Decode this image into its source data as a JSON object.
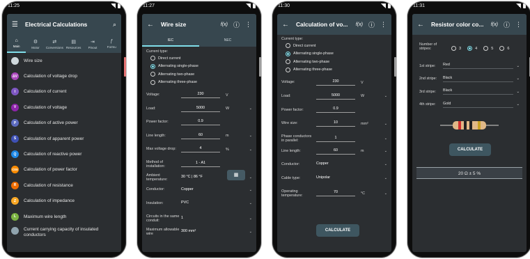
{
  "colors": {
    "appbar": "#37474f",
    "screen_bg": "#2b2e31",
    "accent": "#80deea",
    "power_btn_left": "#e57373"
  },
  "phone1": {
    "status_time": "11:25",
    "title": "Electrical Calculations",
    "tabs": [
      {
        "label": "Main",
        "icon": "home-icon"
      },
      {
        "label": "Motor",
        "icon": "motor-icon"
      },
      {
        "label": "Conversions",
        "icon": "conversion-icon"
      },
      {
        "label": "Resources",
        "icon": "book-icon"
      },
      {
        "label": "Pinout",
        "icon": "pinout-icon"
      },
      {
        "label": "Formu",
        "icon": "formula-icon"
      }
    ],
    "items": [
      {
        "label": "Wire size",
        "badge": "",
        "color": "#cfd8dc"
      },
      {
        "label": "Calculation of voltage drop",
        "badge": "ΔV",
        "color": "#ab47bc"
      },
      {
        "label": "Calculation of current",
        "badge": "I",
        "color": "#7e57c2"
      },
      {
        "label": "Calculation of voltage",
        "badge": "V",
        "color": "#8e24aa"
      },
      {
        "label": "Calculation of active power",
        "badge": "P",
        "color": "#5c6bc0"
      },
      {
        "label": "Calculation of apparent power",
        "badge": "S",
        "color": "#3f51b5"
      },
      {
        "label": "Calculation of reactive power",
        "badge": "Q",
        "color": "#1e88e5"
      },
      {
        "label": "Calculation of power factor",
        "badge": "cos",
        "color": "#fb8c00"
      },
      {
        "label": "Calculation of resistance",
        "badge": "R",
        "color": "#ef6c00"
      },
      {
        "label": "Calculation of impedance",
        "badge": "Z",
        "color": "#f9a825"
      },
      {
        "label": "Maximum wire length",
        "badge": "L",
        "color": "#7cb342"
      },
      {
        "label": "Current carrying capacity of insulated conductors",
        "badge": "",
        "color": "#90a4ae"
      }
    ]
  },
  "phone2": {
    "status_time": "11:27",
    "title": "Wire size",
    "formula_label": "f(x)",
    "tabs": [
      "IEC",
      "NEC"
    ],
    "current_type_label": "Current type:",
    "current_types": [
      "Direct current",
      "Alternating single-phase",
      "Alternating two-phase",
      "Alternating three-phase"
    ],
    "selected_index": 1,
    "fields": [
      {
        "label": "Voltage:",
        "value": "230",
        "unit": "V",
        "dropdown": false
      },
      {
        "label": "Load:",
        "value": "5000",
        "unit": "W",
        "dropdown": true
      },
      {
        "label": "Power factor:",
        "value": "0.9",
        "unit": "",
        "dropdown": false
      },
      {
        "label": "Line length:",
        "value": "60",
        "unit": "m",
        "dropdown": true
      },
      {
        "label": "Max voltage drop:",
        "value": "4",
        "unit": "%",
        "dropdown": true
      },
      {
        "label": "Method of installation:",
        "value": "1 - A1",
        "unit": "",
        "dropdown": false
      },
      {
        "label": "Ambient temperature:",
        "value": "30 °C | 86 °F",
        "unit": "",
        "dropdown": true
      },
      {
        "label": "Conductor:",
        "value": "Copper",
        "unit": "",
        "dropdown": true
      },
      {
        "label": "Insulation:",
        "value": "PVC",
        "unit": "",
        "dropdown": true
      },
      {
        "label": "Circuits in the same conduit:",
        "value": "1",
        "unit": "",
        "dropdown": true
      },
      {
        "label": "Maximum allowable wire",
        "value": "300 mm²",
        "unit": "",
        "dropdown": true
      }
    ]
  },
  "phone3": {
    "status_time": "11:30",
    "title": "Calculation of vo...",
    "formula_label": "f(x)",
    "current_type_label": "Current type:",
    "current_types": [
      "Direct current",
      "Alternating single-phase",
      "Alternating two-phase",
      "Alternating three-phase"
    ],
    "selected_index": 1,
    "fields": [
      {
        "label": "Voltage:",
        "value": "230",
        "unit": "V",
        "dropdown": false
      },
      {
        "label": "Load:",
        "value": "5000",
        "unit": "W",
        "dropdown": true
      },
      {
        "label": "Power factor:",
        "value": "0.9",
        "unit": "",
        "dropdown": false
      },
      {
        "label": "Wire size:",
        "value": "10",
        "unit": "mm²",
        "dropdown": true
      },
      {
        "label": "Phase conductors in parallel:",
        "value": "1",
        "unit": "",
        "dropdown": true
      },
      {
        "label": "Line length:",
        "value": "60",
        "unit": "m",
        "dropdown": true
      },
      {
        "label": "Conductor:",
        "value": "Copper",
        "unit": "",
        "dropdown": true
      },
      {
        "label": "Cable type:",
        "value": "Unipolar",
        "unit": "",
        "dropdown": true
      },
      {
        "label": "Operating temperature:",
        "value": "70",
        "unit": "°C",
        "dropdown": true
      }
    ],
    "calculate_label": "CALCULATE"
  },
  "phone4": {
    "status_time": "11:31",
    "title": "Resistor color co...",
    "formula_label": "f(x)",
    "stripes_label": "Number of stripes:",
    "stripe_options": [
      "3",
      "4",
      "5",
      "6"
    ],
    "selected_stripes": "4",
    "stripes": [
      {
        "label": "1st stripe:",
        "value": "Red"
      },
      {
        "label": "2nd stripe:",
        "value": "Black"
      },
      {
        "label": "3rd stripe:",
        "value": "Black"
      },
      {
        "label": "4th stripe:",
        "value": "Gold"
      }
    ],
    "band_colors": [
      "#d32f2f",
      "#212121",
      "#212121",
      "#c9a227"
    ],
    "calculate_label": "CALCULATE",
    "result": "20 Ω ± 5 %"
  }
}
